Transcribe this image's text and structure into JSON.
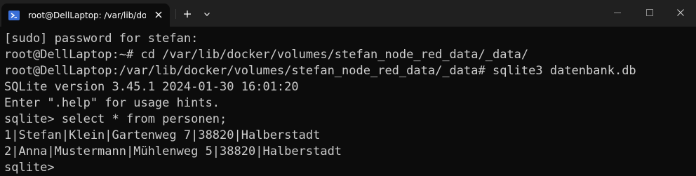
{
  "window": {
    "tab_title": "root@DellLaptop: /var/lib/dock",
    "tab_icon": "powershell-icon",
    "accent_color": "#0c0c0c",
    "titlebar_color": "#202020"
  },
  "terminal": {
    "lines": [
      "[sudo] password for stefan:",
      "root@DellLaptop:~# cd /var/lib/docker/volumes/stefan_node_red_data/_data/",
      "root@DellLaptop:/var/lib/docker/volumes/stefan_node_red_data/_data# sqlite3 datenbank.db",
      "SQLite version 3.45.1 2024-01-30 16:01:20",
      "Enter \".help\" for usage hints.",
      "sqlite> select * from personen;",
      "1|Stefan|Klein|Gartenweg 7|38820|Halberstadt",
      "2|Anna|Mustermann|Mühlenweg 5|38820|Halberstadt",
      "sqlite>"
    ]
  }
}
